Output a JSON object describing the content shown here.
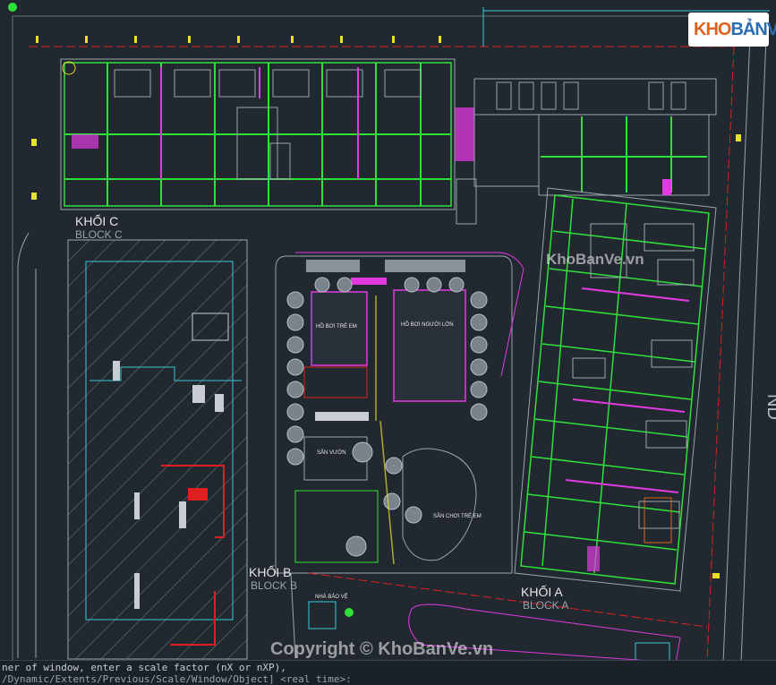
{
  "logo": {
    "text_a": "KHO",
    "text_b": "BẢN",
    "text_c": "VẼ"
  },
  "watermarks": {
    "top": "KhoBanVe.vn",
    "bottom": "Copyright © KhoBanVe.vn"
  },
  "blocks": {
    "c_vn": "KHỐI C",
    "c_en": "BLOCK C",
    "b_vn": "KHỐI B",
    "b_en": "BLOCK B",
    "a_vn": "KHỐI A",
    "a_en": "BLOCK A"
  },
  "zones": {
    "kids_pool": "HỒ BƠI TRẺ EM",
    "adult_pool": "HỒ BƠI NGƯỜI LỚN",
    "garden": "SÂN VƯỜN",
    "playground": "SÂN CHƠI TRẺ EM",
    "guard_house": "NHÀ BẢO VỆ"
  },
  "road_label": "ND",
  "command_line": {
    "line1": "ner of window, enter a scale factor (nX or nXP),",
    "line2": "/Dynamic/Extents/Previous/Scale/Window/Object] <real time>:"
  },
  "colors": {
    "background": "#212830",
    "green": "#2fe23a",
    "magenta": "#e23ae0",
    "red": "#e02020",
    "cyan": "#38c8d8",
    "yellow": "#e8e02a"
  }
}
